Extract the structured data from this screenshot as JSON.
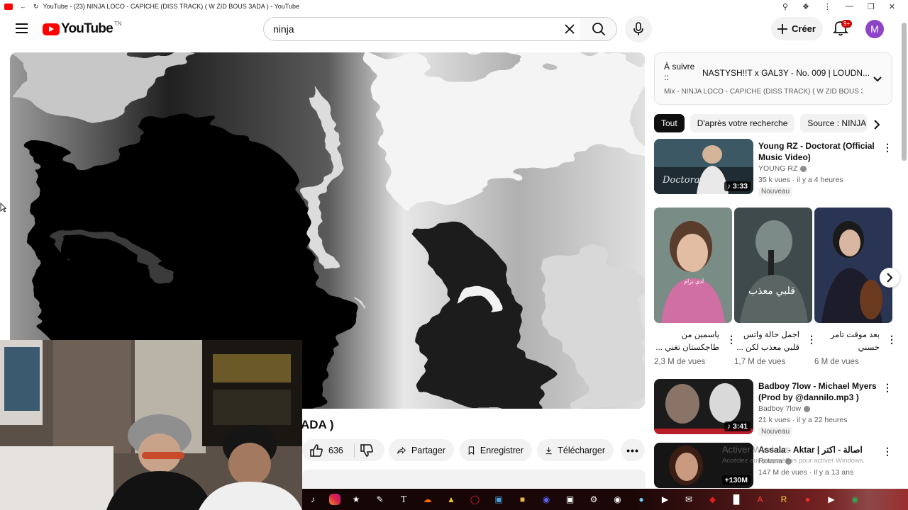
{
  "window": {
    "title": "YouTube - (23) NINJA LOCO - CAPICHE (DISS TRACK) ( W ZID BOUS 3ADA ) - YouTube"
  },
  "masthead": {
    "logo_text": "YouTube",
    "country_code": "TN",
    "search_value": "ninja",
    "create_label": "Créer",
    "notification_count": "9+",
    "avatar_initial": "M"
  },
  "video": {
    "title_fragment": "ADA )",
    "like_count": "636",
    "share_label": "Partager",
    "save_label": "Enregistrer",
    "download_label": "Télécharger"
  },
  "up_next": {
    "label": "À suivre ::",
    "title": "NASTYSH!!T x GAL3Y - No. 009 | LOUDN...",
    "subtitle": "Mix - NINJA LOCO - CAPICHE (DISS TRACK) ( W ZID BOUS 3..."
  },
  "chips": [
    {
      "label": "Tout",
      "active": true
    },
    {
      "label": "D'après votre recherche",
      "active": false
    },
    {
      "label": "Source : NINJA",
      "active": false
    }
  ],
  "recommendations": [
    {
      "title": "Young RZ - Doctorat (Official Music Video)",
      "channel": "YOUNG RZ",
      "verified": true,
      "meta": "35 k vues · il y a 4 heures",
      "badge": "Nouveau",
      "duration": "♪ 3:33"
    },
    {
      "title": "Badboy 7low - Michael Myers (Prod by @dannilo.mp3 )",
      "channel": "Badboy 7low",
      "verified": true,
      "meta": "21 k vues · il y a 22 heures",
      "badge": "Nouveau",
      "duration": "♪ 3:41"
    },
    {
      "title": "Assala - Aktar | اصالة - اكتر",
      "channel": "Rotana",
      "verified": true,
      "meta": "147 M de vues · il y a 13 ans",
      "badge": "",
      "duration": "+130M"
    }
  ],
  "shorts": [
    {
      "title": "ياسمين من طاجكستان تغني ...",
      "views": "2,3 M de vues"
    },
    {
      "title": "اجمل حالة واتس قلبي معذب لكن ...",
      "views": "1,7 M de vues"
    },
    {
      "title": "بعد موقت تامر حسني",
      "views": "6 M de vues"
    }
  ],
  "watermark": {
    "line1": "Activer Windows",
    "line2": "Accédez aux paramètres pour activer Windows."
  },
  "colors": {
    "brand": "#ff0000",
    "avatar": "#8e44c9",
    "chip_active": "#0f0f0f",
    "notification_badge": "#cc0000"
  }
}
